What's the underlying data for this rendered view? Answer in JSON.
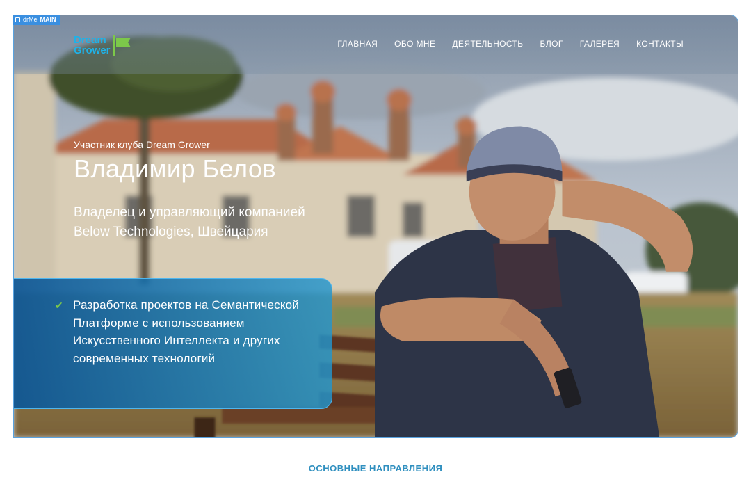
{
  "editor_badge": {
    "text_left": "drMe",
    "text_right": "MAIN"
  },
  "logo": {
    "line1": "Dream",
    "line2": "Grower",
    "flag_color": "#7cc84a",
    "text_color": "#1fb2e8"
  },
  "nav": [
    "ГЛАВНАЯ",
    "ОБО МНЕ",
    "ДЕЯТЕЛЬНОСТЬ",
    "БЛОГ",
    "ГАЛЕРЕЯ",
    "КОНТАКТЫ"
  ],
  "hero": {
    "kicker": "Участник клуба Dream Grower",
    "name": "Владимир Белов",
    "role_line1": "Владелец и управляющий компанией",
    "role_line2": "Below Technologies, Швейцария",
    "panel": {
      "icon": "check-icon",
      "text": "Разработка проектов на Семантической Платформе с использованием Искусственного Интеллекта и других современных технологий"
    }
  },
  "section": {
    "label": "ОСНОВНЫЕ НАПРАВЛЕНИЯ"
  },
  "colors": {
    "accent": "#2f8fbf",
    "panel": "#1f78b8",
    "check": "#7cc84a"
  }
}
